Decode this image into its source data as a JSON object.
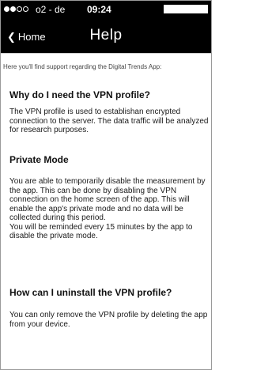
{
  "status_bar": {
    "carrier": "o2 - de",
    "time": "09:24",
    "signal_bars_full": 2,
    "signal_bars_total": 5
  },
  "nav": {
    "back_label": "Home",
    "title": "Help"
  },
  "content": {
    "intro": "Here you'll find support regarding the Digital Trends App:",
    "sections": [
      {
        "heading": "Why do I need the VPN profile?",
        "body": "The VPN profile is used to establishan encrypted connection to the server. The data traffic will be analyzed for research purposes."
      },
      {
        "heading": "Private Mode",
        "body": "You are able to temporarily disable the measurement by the app. This can be done by disabling the VPN connection on the home screen of the app. This will enable the app's private mode and no data will be collected during this period.",
        "body2": "You will be reminded every 15 minutes by the app to disable the private mode."
      },
      {
        "heading": "How can I uninstall the VPN profile?",
        "body": "You can only remove the VPN profile by deleting the app from your device."
      }
    ]
  },
  "colors": {
    "bar_background": "#000000",
    "bar_text": "#ffffff",
    "page_background": "#ffffff",
    "body_text": "#1a1a1a"
  }
}
